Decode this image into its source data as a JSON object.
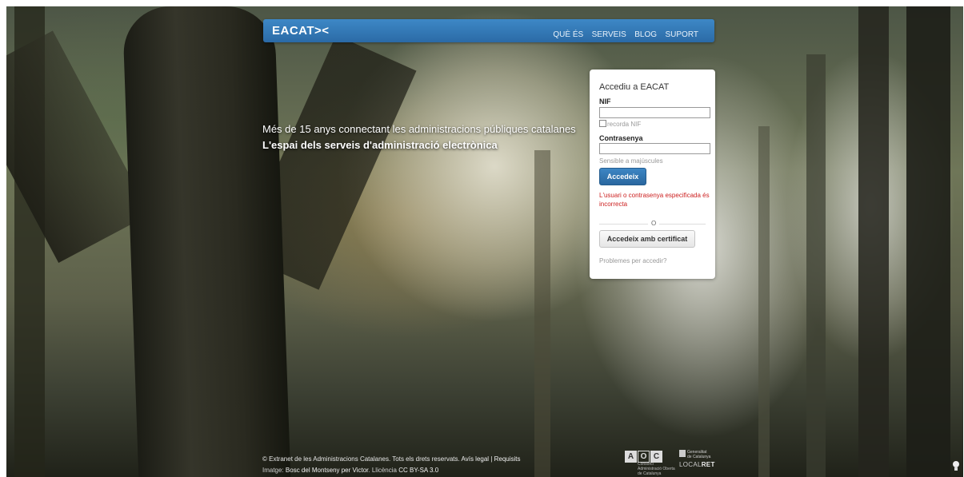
{
  "navbar": {
    "logo": "EACAT><",
    "links": [
      "QUÈ ÉS",
      "SERVEIS",
      "BLOG",
      "SUPORT"
    ]
  },
  "hero": {
    "headline": "Més de 15 anys connectant les administracions públiques catalanes",
    "subhead": "L'espai dels serveis d'administració electrònica"
  },
  "login": {
    "title": "Accediu a EACAT",
    "nif_label": "NIF",
    "nif_value": "",
    "remember_label": "recorda NIF",
    "password_label": "Contrasenya",
    "password_value": "",
    "caps_hint": "Sensible a majúscules",
    "submit_label": "Accedeix",
    "error_message": "L'usuari o contrasenya especificada és incorrecta",
    "or_label": "O",
    "certificate_label": "Accedeix amb certificat",
    "problems_link": "Problemes per accedir?"
  },
  "footer": {
    "copyright": "© Extranet de les Administracions Catalanes. Tots els drets reservats.",
    "legal_link": "Avís legal",
    "separator": "|",
    "requirements_link": "Requisits",
    "image_prefix": "Imatge:",
    "image_link": "Bosc del Montseny per Victor",
    "license_prefix": ". Llicència",
    "license_link": "CC BY-SA 3.0"
  },
  "logos": {
    "aoc_letters": [
      "A",
      "O",
      "C"
    ],
    "aoc_caption": "Consorci Administració Oberta de Catalunya",
    "gencat_caption": "Generalitat de Catalunya",
    "localret_prefix": "LOCAL",
    "localret_suffix": "RET"
  },
  "colors": {
    "navbar": "#2b6aa6",
    "button_primary": "#2a679f",
    "error": "#cc1f1f"
  }
}
